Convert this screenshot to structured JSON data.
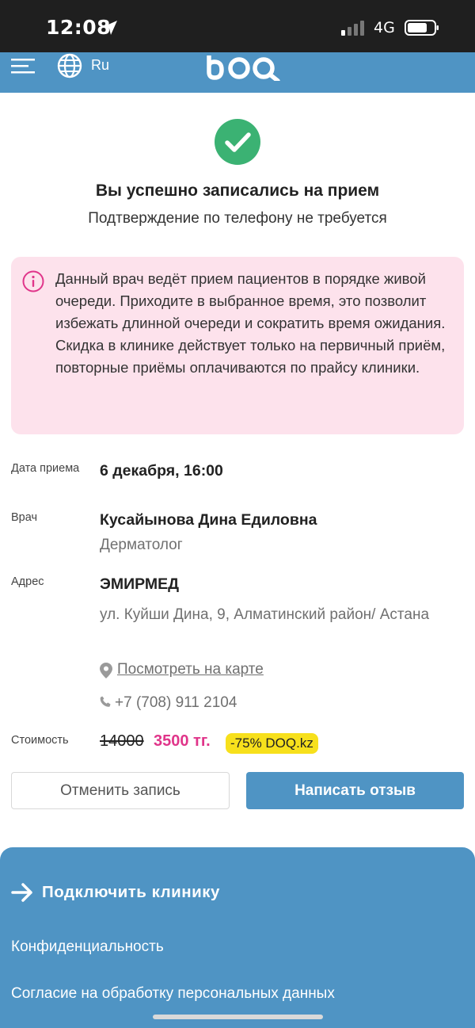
{
  "status_bar": {
    "time": "12:08",
    "network": "4G"
  },
  "header": {
    "language": "Ru",
    "logo_text": "DOQ"
  },
  "success": {
    "title": "Вы успешно записались на прием",
    "subtitle": "Подтверждение по телефону не требуется"
  },
  "notice": {
    "text": "Данный врач ведёт прием пациентов в порядке живой очереди. Приходите в выбранное время, это позволит избежать длинной очереди и сократить время ожидания. Скидка в клинике действует только на первичный приём, повторные приёмы оплачиваются по прайсу клиники."
  },
  "details": {
    "date_label": "Дата приема",
    "date_value": "6 декабря, 16:00",
    "doctor_label": "Врач",
    "doctor_name": "Кусайынова Дина Едиловна",
    "doctor_specialty": "Дерматолог",
    "address_label": "Адрес",
    "clinic_name": "ЭМИРМЕД",
    "address_text": "ул. Куйши Дина, 9, Алматинский район/ Астана",
    "map_link": "Посмотреть на карте",
    "phone": "+7 (708) 911 2104",
    "cost_label": "Стоимость",
    "old_price": "14000",
    "new_price": "3500 тг.",
    "discount": "-75%  DOQ.kz"
  },
  "buttons": {
    "cancel": "Отменить запись",
    "review": "Написать отзыв"
  },
  "footer": {
    "connect_clinic": "Подключить клинику",
    "privacy": "Конфиденциальность",
    "consent": "Согласие на обработку персональных данных"
  },
  "colors": {
    "brand_blue": "#4f94c4",
    "success_green": "#3bb273",
    "notice_bg": "#fde2ec",
    "price_pink": "#e0358a",
    "badge_yellow": "#f7e01c"
  },
  "icons": [
    "location-arrow-icon",
    "signal-icon",
    "battery-icon",
    "menu-icon",
    "globe-icon",
    "check-circle-icon",
    "info-icon",
    "map-pin-icon",
    "phone-icon",
    "arrow-right-icon"
  ]
}
